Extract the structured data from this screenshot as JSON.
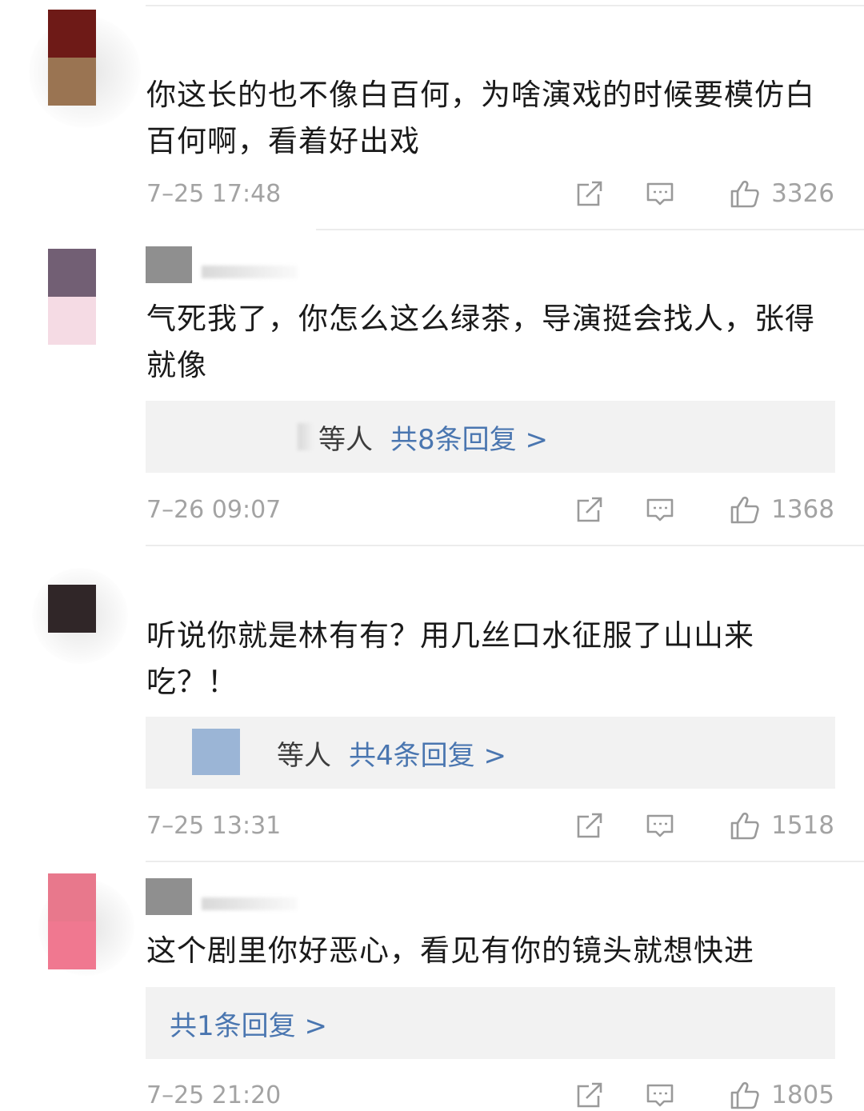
{
  "comments": [
    {
      "text": "你这长的也不像白百何，为啥演戏的时候要模仿白百何啊，看着好出戏",
      "time": "7–25 17:48",
      "likes": "3326",
      "avatar_colors": [
        "#6e1a17",
        "#9a7452"
      ]
    },
    {
      "text": "气死我了，你怎么这么绿茶，导演挺会找人，张得就像",
      "replies_who": "等人",
      "replies_count": "共8条回复 >",
      "time": "7–26 09:07",
      "likes": "1368",
      "avatar_colors": [
        "#725f74",
        "#f5dbe4"
      ]
    },
    {
      "text": "听说你就是林有有？用几丝口水征服了山山来吃？！",
      "replies_who": "等人",
      "replies_count": "共4条回复 >",
      "time": "7–25 13:31",
      "likes": "1518",
      "avatar_colors": [
        "#302628",
        "#302628"
      ]
    },
    {
      "text": "这个剧里你好恶心，看见有你的镜头就想快进",
      "replies_count": "共1条回复 >",
      "time": "7–25 21:20",
      "likes": "1805",
      "avatar_colors": [
        "#e8788c",
        "#f07890"
      ]
    }
  ],
  "icons": [
    "share-icon",
    "comment-icon",
    "like-icon"
  ],
  "colors": {
    "reply_link": "#4a76b0",
    "meta_gray": "#a3a3a3",
    "reply_bg": "#f2f2f2"
  }
}
